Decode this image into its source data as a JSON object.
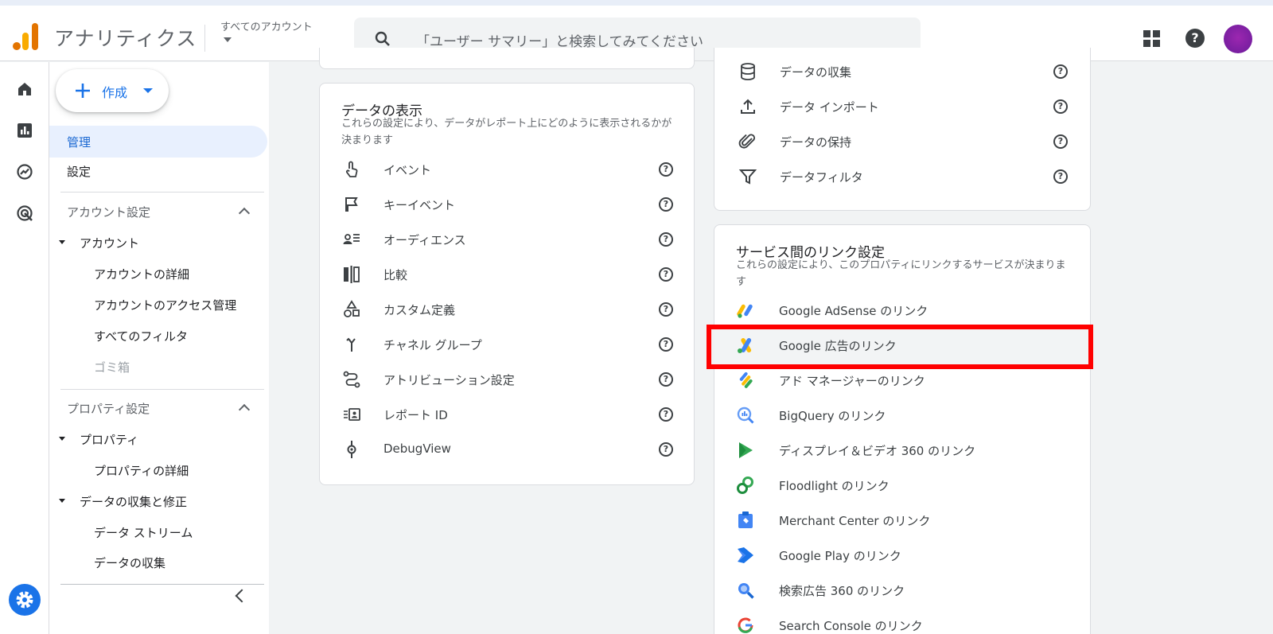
{
  "app": {
    "name": "アナリティクス",
    "account_selector": "すべてのアカウント"
  },
  "search": {
    "placeholder": "「ユーザー サマリー」と検索してみてください"
  },
  "create_button": {
    "label": "作成"
  },
  "nav": {
    "admin": "管理",
    "settings": "設定",
    "account_settings": "アカウント設定",
    "account": "アカウント",
    "account_items": [
      "アカウントの詳細",
      "アカウントのアクセス管理",
      "すべてのフィルタ",
      "ゴミ箱"
    ],
    "property_settings": "プロパティ設定",
    "property": "プロパティ",
    "property_items": [
      "プロパティの詳細"
    ],
    "data_collection": "データの収集と修正",
    "data_collection_items": [
      "データ ストリーム",
      "データの収集"
    ]
  },
  "display_card": {
    "title": "データの表示",
    "desc": "これらの設定により、データがレポート上にどのように表示されるかが決まります",
    "items": [
      "イベント",
      "キーイベント",
      "オーディエンス",
      "比較",
      "カスタム定義",
      "チャネル グループ",
      "アトリビューション設定",
      "レポート ID",
      "DebugView"
    ]
  },
  "collection_card": {
    "items": [
      "データの収集",
      "データ インポート",
      "データの保持",
      "データフィルタ"
    ]
  },
  "links_card": {
    "title": "サービス間のリンク設定",
    "desc": "これらの設定により、このプロパティにリンクするサービスが決まります",
    "items": [
      "Google AdSense のリンク",
      "Google 広告のリンク",
      "アド マネージャーのリンク",
      "BigQuery のリンク",
      "ディスプレイ＆ビデオ 360 のリンク",
      "Floodlight のリンク",
      "Merchant Center のリンク",
      "Google Play のリンク",
      "検索広告 360 のリンク",
      "Search Console のリンク"
    ]
  },
  "colors": {
    "accent": "#1a73e8",
    "highlight": "#ff0000"
  }
}
